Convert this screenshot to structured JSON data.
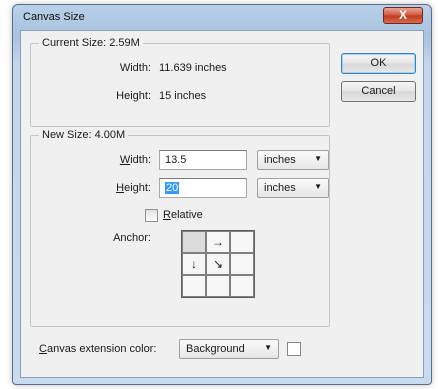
{
  "window": {
    "title": "Canvas Size",
    "close_label": "X"
  },
  "current_size": {
    "legend": "Current Size: 2.59M",
    "width_label": "Width:",
    "width_value": "11.639 inches",
    "height_label": "Height:",
    "height_value": "15 inches"
  },
  "new_size": {
    "legend": "New Size: 4.00M",
    "width_label": "Width:",
    "width_value": "13.5",
    "width_unit": "inches",
    "height_label": "Height:",
    "height_value": "20",
    "height_unit": "inches",
    "relative_label": "Relative",
    "anchor_label": "Anchor:",
    "anchor_cells": [
      "",
      "→",
      "",
      "↓",
      "↘",
      "",
      "",
      "",
      ""
    ]
  },
  "buttons": {
    "ok_label": "OK",
    "cancel_label": "Cancel"
  },
  "extension": {
    "label": "Canvas extension color:",
    "value": "Background",
    "swatch_color": "#ffffff"
  },
  "colors": {
    "accent": "#3399ff",
    "close": "#c0391f"
  }
}
